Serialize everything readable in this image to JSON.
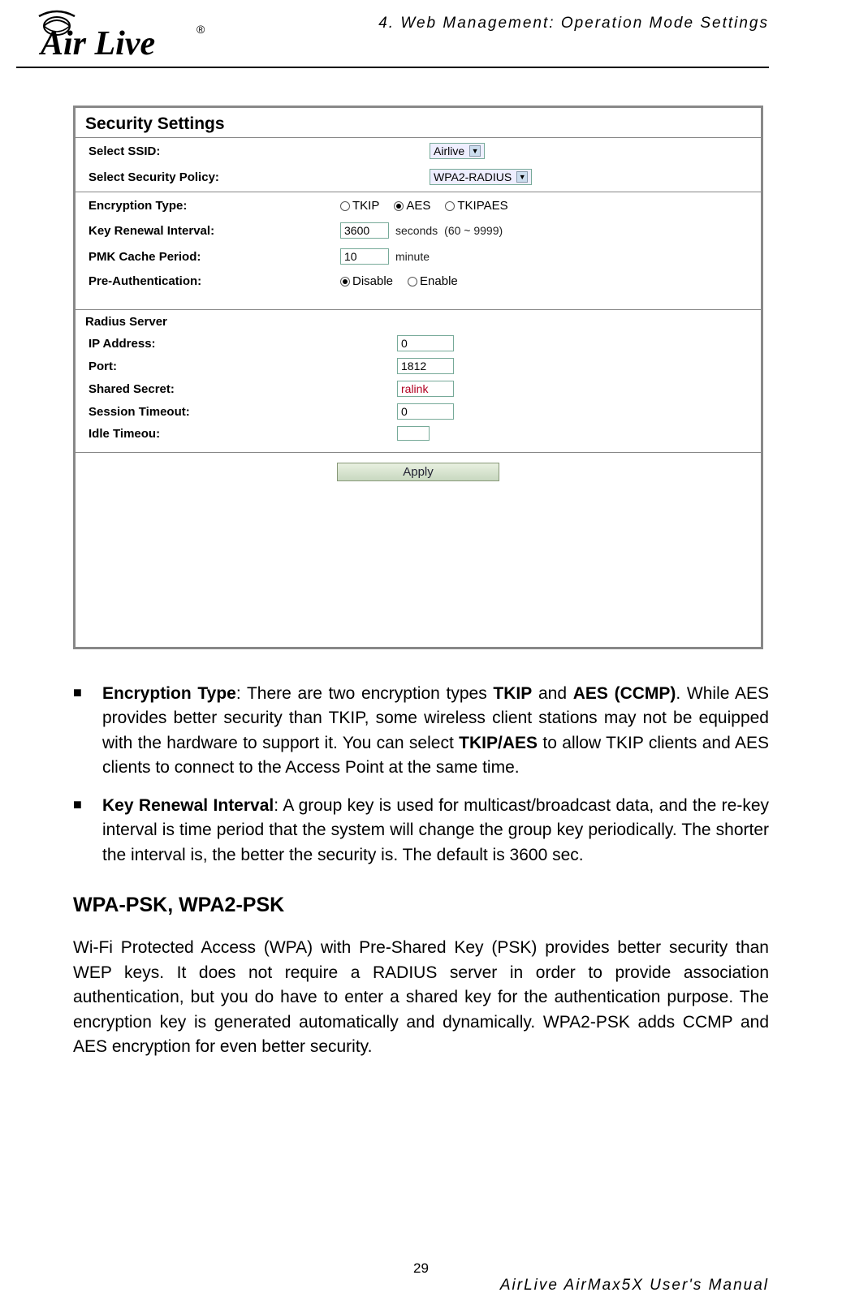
{
  "page_header": "4. Web Management: Operation Mode Settings",
  "logo_text": "Air Live",
  "screenshot": {
    "title": "Security Settings",
    "select_ssid_label": "Select SSID:",
    "select_ssid_value": "Airlive",
    "select_policy_label": "Select Security Policy:",
    "select_policy_value": "WPA2-RADIUS",
    "encryption_type_label": "Encryption Type:",
    "enc_opts": {
      "tkip": "TKIP",
      "aes": "AES",
      "tkipaes": "TKIPAES"
    },
    "key_renewal_label": "Key Renewal Interval:",
    "key_renewal_value": "3600",
    "key_renewal_unit": "seconds",
    "key_renewal_range": "(60 ~ 9999)",
    "pmk_label": "PMK Cache Period:",
    "pmk_value": "10",
    "pmk_unit": "minute",
    "preauth_label": "Pre-Authentication:",
    "preauth_opts": {
      "disable": "Disable",
      "enable": "Enable"
    },
    "radius_header": "Radius Server",
    "ip_label": "IP Address:",
    "ip_value": "0",
    "port_label": "Port:",
    "port_value": "1812",
    "secret_label": "Shared Secret:",
    "secret_value": "ralink",
    "session_label": "Session Timeout:",
    "session_value": "0",
    "idle_label": "Idle Timeou:",
    "idle_value": "",
    "apply_label": "Apply"
  },
  "bullets": {
    "enc_title": "Encryption Type",
    "enc_text_1": ": There are two encryption types ",
    "enc_tkip": "TKIP",
    "enc_and": " and ",
    "enc_aes": "AES (CCMP)",
    "enc_text_2": ". While AES provides better security than TKIP, some wireless client stations may not be equipped with the hardware to support it. You can select ",
    "enc_tkipaes": "TKIP/AES",
    "enc_text_3": " to allow TKIP clients and AES clients to connect to the Access Point at the same time.",
    "key_title": "Key Renewal Interval",
    "key_text": ": A group key is used for multicast/broadcast data, and the re-key interval is time period that the system will change the group key periodically. The shorter the interval is, the better the security is. The default is 3600 sec."
  },
  "heading": "WPA-PSK, WPA2-PSK",
  "paragraph": "Wi-Fi Protected Access (WPA) with Pre-Shared Key (PSK) provides better security than WEP keys. It does not require a RADIUS server in order to provide association authentication, but you do have to enter a shared key for the authentication purpose. The encryption key is generated automatically and dynamically. WPA2-PSK adds CCMP and AES encryption for even better security.",
  "page_number": "29",
  "footer": "AirLive AirMax5X User's Manual"
}
